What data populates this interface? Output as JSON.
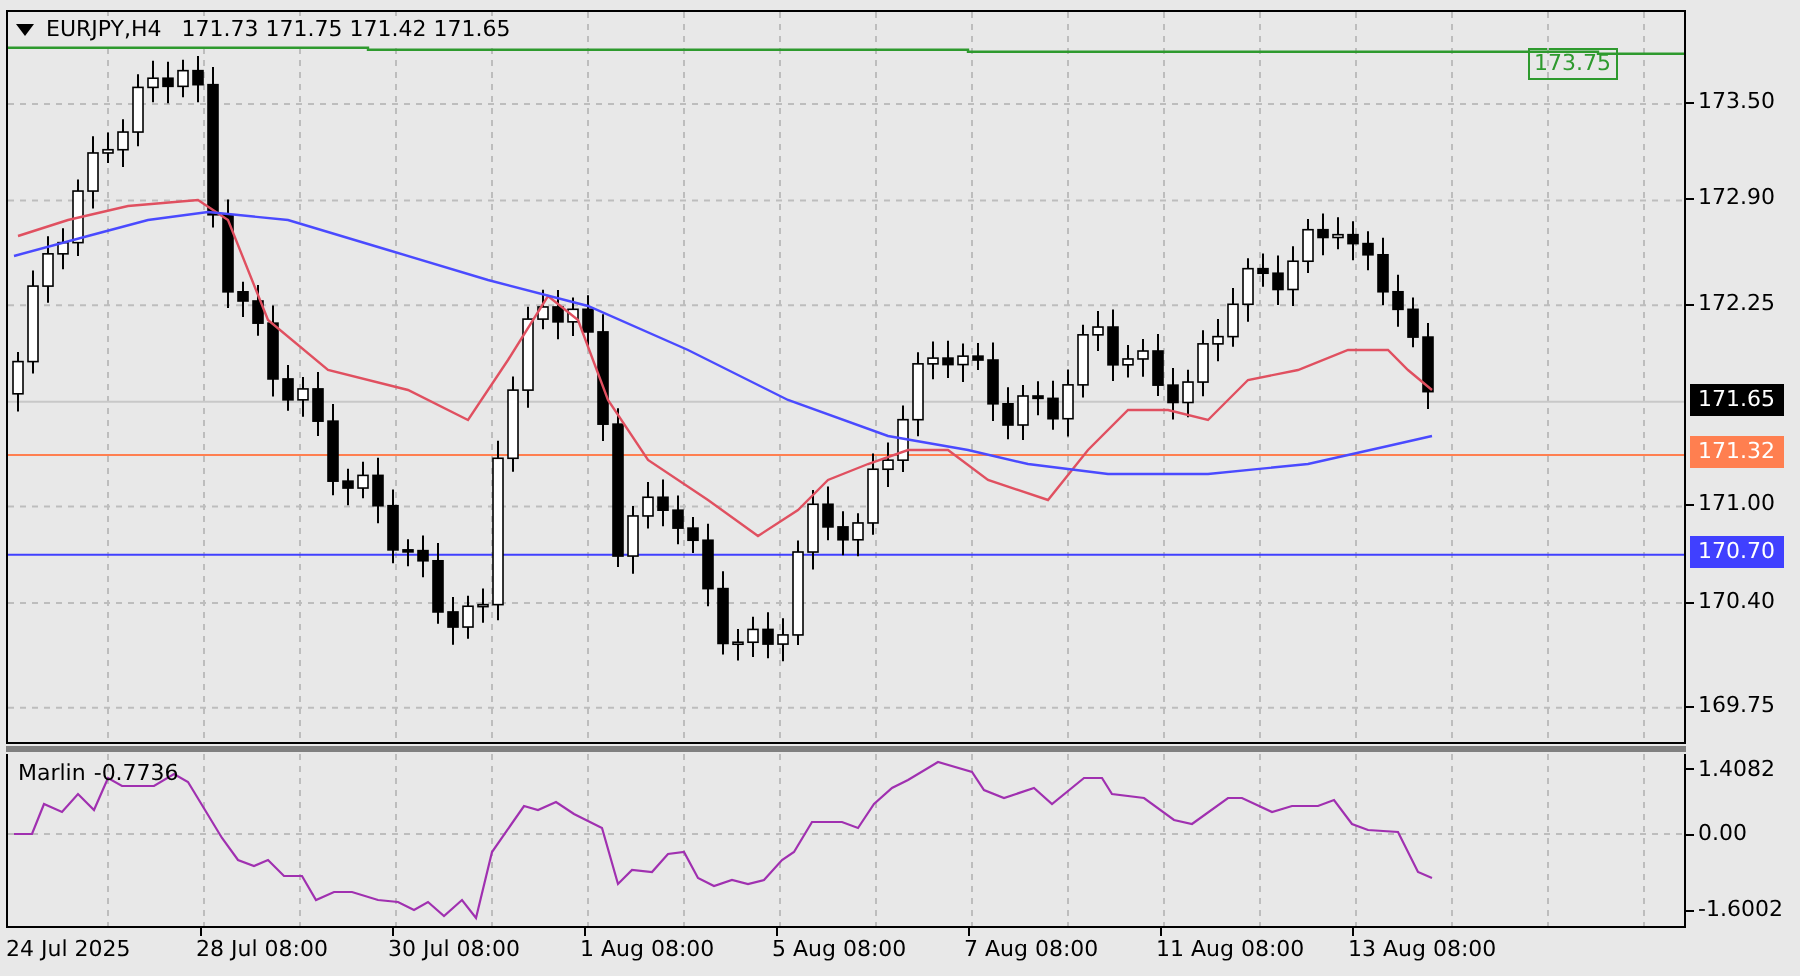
{
  "header": {
    "symbol": "EURJPY,H4",
    "ohlc": "171.73 171.75 171.42 171.65"
  },
  "price_axis": {
    "ticks": [
      "173.50",
      "172.90",
      "172.25",
      "171.00",
      "170.40",
      "169.75"
    ]
  },
  "levels": [
    {
      "label": "173.75",
      "kind": "boxed",
      "color": "#2e9a2e"
    },
    {
      "label": "171.65",
      "kind": "tag",
      "color": "#000000"
    },
    {
      "label": "171.32",
      "kind": "tag",
      "color": "#ff7f50"
    },
    {
      "label": "170.70",
      "kind": "tag",
      "color": "#4040ff"
    }
  ],
  "indicator": {
    "name": "Marlin",
    "value": "-0.7736",
    "axis_ticks": [
      "1.4082",
      "0.00",
      "-1.6002"
    ]
  },
  "time_axis": {
    "labels": [
      "24 Jul 2025",
      "28 Jul 08:00",
      "30 Jul 08:00",
      "1 Aug 08:00",
      "5 Aug 08:00",
      "7 Aug 08:00",
      "11 Aug 08:00",
      "13 Aug 08:00"
    ]
  }
}
